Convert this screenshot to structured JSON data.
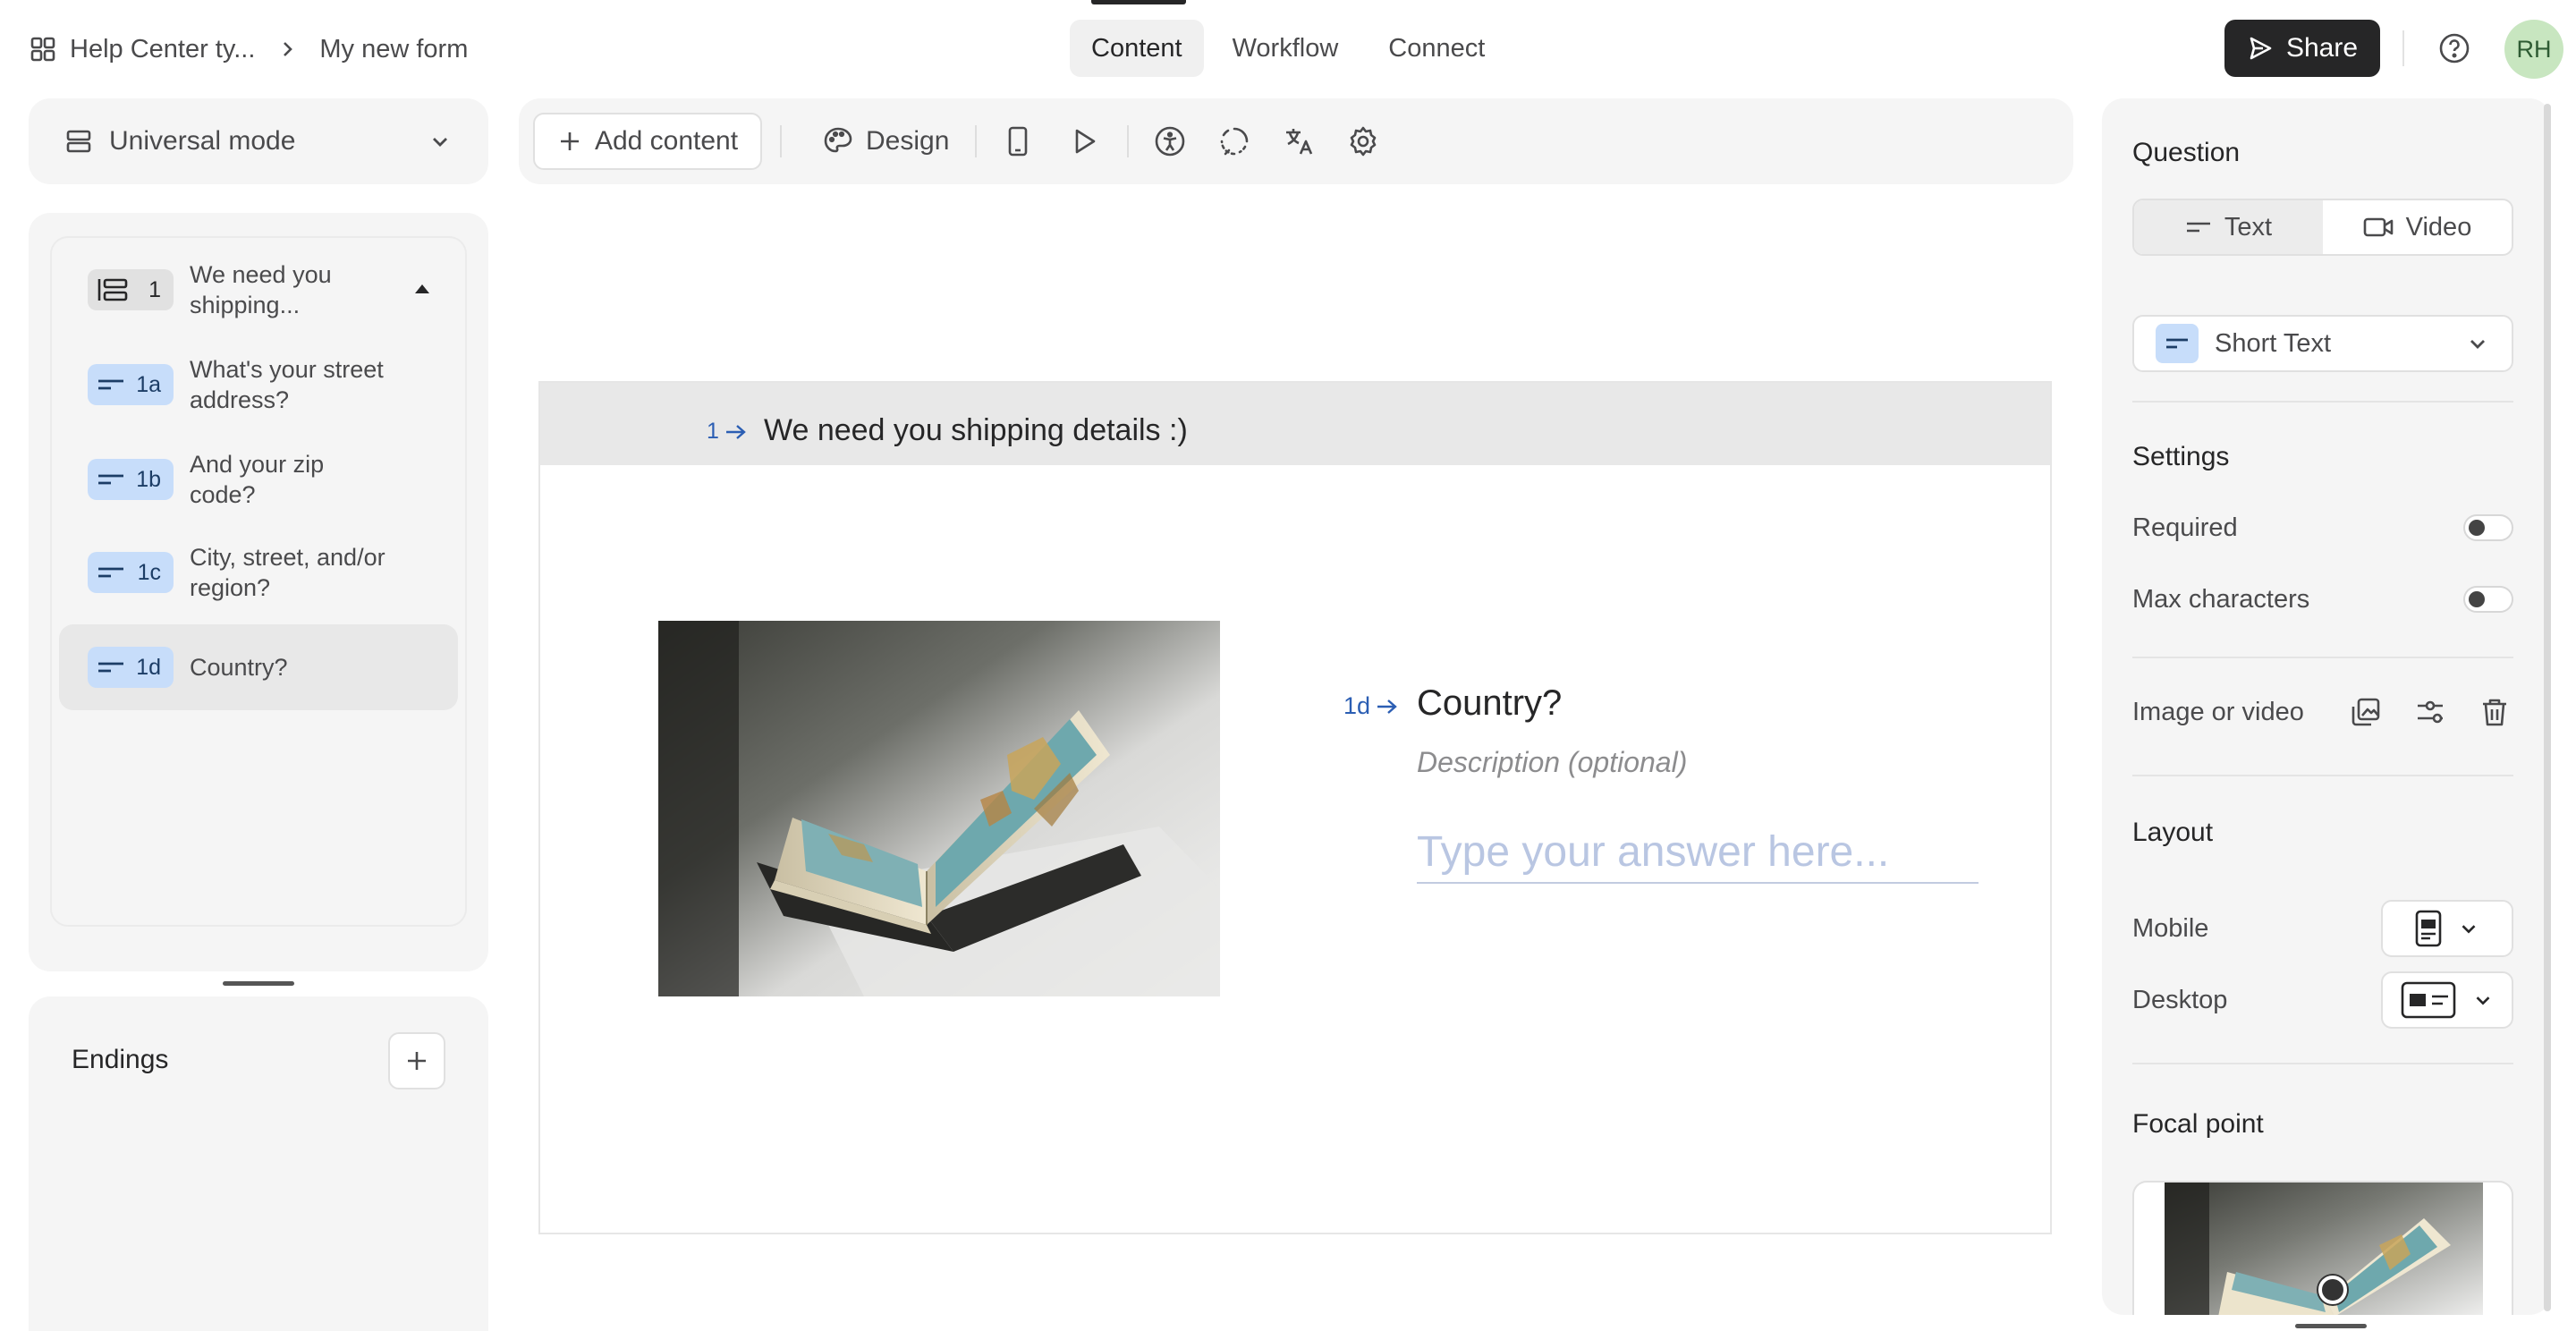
{
  "breadcrumb": {
    "workspace": "Help Center ty...",
    "form": "My new form"
  },
  "tabs": [
    {
      "label": "Content",
      "active": true
    },
    {
      "label": "Workflow",
      "active": false
    },
    {
      "label": "Connect",
      "active": false
    }
  ],
  "header": {
    "share_label": "Share",
    "avatar_initials": "RH"
  },
  "left": {
    "mode": "Universal mode",
    "items": [
      {
        "badge": "1",
        "label": "We need you shipping...",
        "kind": "group"
      },
      {
        "badge": "1a",
        "label": "What's your street address?",
        "kind": "short-text"
      },
      {
        "badge": "1b",
        "label": "And your zip code?",
        "kind": "short-text"
      },
      {
        "badge": "1c",
        "label": "City, street, and/or region?",
        "kind": "short-text"
      },
      {
        "badge": "1d",
        "label": "Country?",
        "kind": "short-text",
        "selected": true
      }
    ],
    "endings_label": "Endings"
  },
  "toolbar": {
    "add_content": "Add content",
    "design": "Design"
  },
  "canvas": {
    "group_number": "1",
    "group_title": "We need you shipping details :)",
    "question_number": "1d",
    "question_title": "Country?",
    "description_placeholder": "Description (optional)",
    "answer_placeholder": "Type your answer here..."
  },
  "right": {
    "question_heading": "Question",
    "seg_text": "Text",
    "seg_video": "Video",
    "question_type": "Short Text",
    "settings_heading": "Settings",
    "required_label": "Required",
    "required_on": false,
    "max_chars_label": "Max characters",
    "max_chars_on": false,
    "image_video_label": "Image or video",
    "layout_heading": "Layout",
    "mobile_label": "Mobile",
    "desktop_label": "Desktop",
    "focal_heading": "Focal point"
  },
  "colors": {
    "accent_blue": "#2b5eb3",
    "badge_blue": "#c7ddfa",
    "primary_dark": "#262627"
  }
}
